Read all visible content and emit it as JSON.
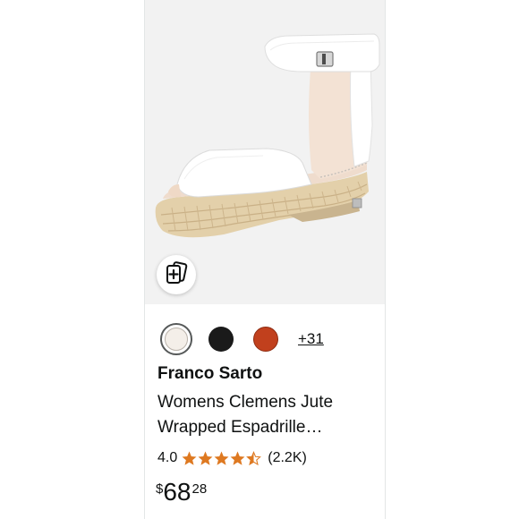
{
  "product": {
    "brand": "Franco Sarto",
    "title": "Womens Clemens Jute Wrapped Espadrille…",
    "image_icon": "white-espadrille-wedge-sandal",
    "compare_icon": "add-to-compare-icon"
  },
  "colors": {
    "swatches": [
      {
        "name": "white",
        "hex": "#f4efe9",
        "selected": true
      },
      {
        "name": "black",
        "hex": "#1a1a1a",
        "selected": false
      },
      {
        "name": "rust",
        "hex": "#c1401d",
        "selected": false
      }
    ],
    "more_label": "+31"
  },
  "rating": {
    "value": "4.0",
    "stars": 4.5,
    "reviews": "(2.2K)",
    "star_color": "#de7921"
  },
  "price": {
    "symbol": "$",
    "whole": "68",
    "fraction": "28"
  }
}
